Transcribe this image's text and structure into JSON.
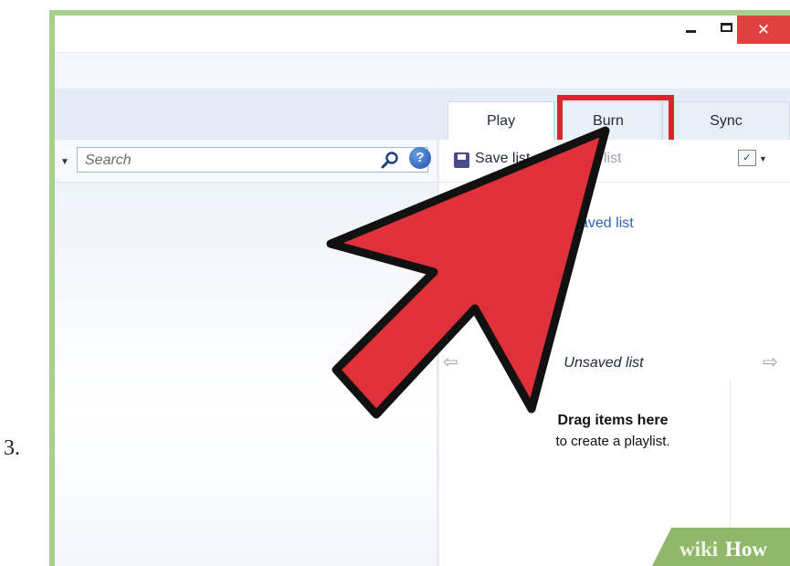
{
  "step_number": "3.",
  "window": {
    "minimize_glyph": "‒",
    "close_glyph": "✕",
    "close_color": "#e04040"
  },
  "search": {
    "placeholder": "Search",
    "help_glyph": "?"
  },
  "tabs": [
    {
      "label": "Play"
    },
    {
      "label": "Burn"
    },
    {
      "label": "Sync"
    }
  ],
  "list_toolbar": {
    "save_label": "Save list",
    "clear_label": "list"
  },
  "saved_list_link": "saved list",
  "playlist": {
    "title": "Unsaved list",
    "empty_title": "Drag items here",
    "empty_subtitle": "to create a playlist."
  },
  "annotation": {
    "highlighted_tab": "Burn",
    "highlight_color": "#d9262e",
    "arrow_color": "#e0303a"
  },
  "watermark": {
    "text_1": "wiki",
    "text_2": "How"
  }
}
